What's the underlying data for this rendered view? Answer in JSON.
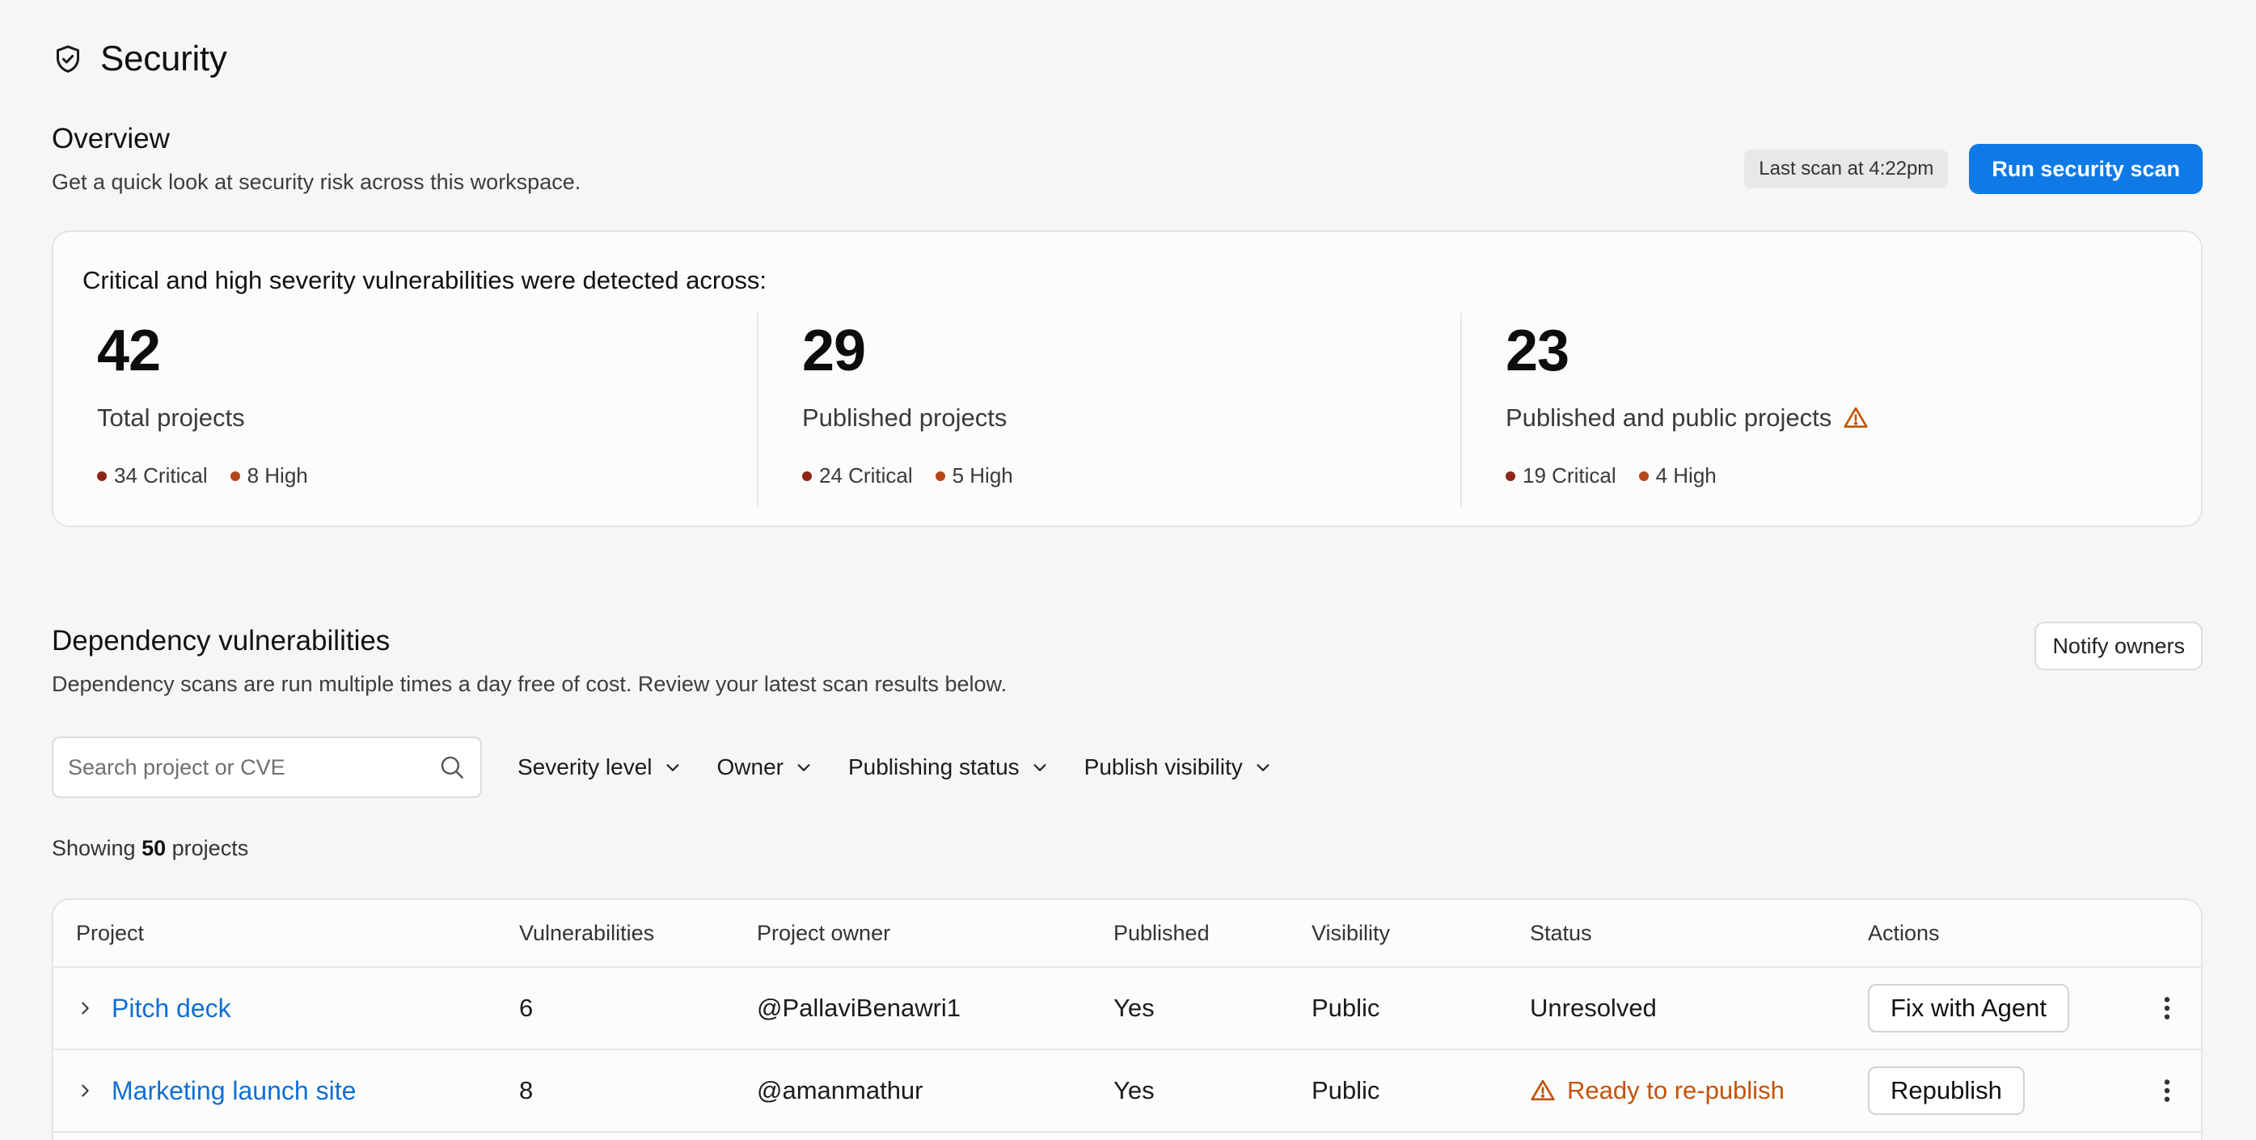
{
  "page": {
    "title": "Security",
    "icon": "shield-check-icon"
  },
  "overview": {
    "title": "Overview",
    "description": "Get a quick look at security risk across this workspace.",
    "last_scan": "Last scan at 4:22pm",
    "run_scan_label": "Run security scan",
    "accent_color": "#0f7ae5"
  },
  "summary": {
    "lead": "Critical and high severity vulnerabilities were detected across:",
    "stats": [
      {
        "value": "42",
        "label": "Total projects",
        "critical": "34 Critical",
        "high": "8 High",
        "warning": false
      },
      {
        "value": "29",
        "label": "Published projects",
        "critical": "24 Critical",
        "high": "5 High",
        "warning": false
      },
      {
        "value": "23",
        "label": "Published and public projects",
        "critical": "19 Critical",
        "high": "4 High",
        "warning": true
      }
    ],
    "critical_color": "#8e2618",
    "high_color": "#b7471a"
  },
  "dependencies": {
    "title": "Dependency vulnerabilities",
    "description": "Dependency scans are run multiple times a day free of cost. Review your latest scan results below.",
    "notify_label": "Notify owners",
    "search_placeholder": "Search project or CVE",
    "filters": [
      "Severity level",
      "Owner",
      "Publishing status",
      "Publish visibility"
    ],
    "showing_prefix": "Showing",
    "showing_count": "50",
    "showing_suffix": "projects"
  },
  "table": {
    "columns": [
      "Project",
      "Vulnerabilities",
      "Project owner",
      "Published",
      "Visibility",
      "Status",
      "Actions"
    ],
    "rows": [
      {
        "project": "Pitch deck",
        "vulnerabilities": "6",
        "owner": "@PallaviBenawri1",
        "published": "Yes",
        "visibility": "Public",
        "status": "Unresolved",
        "status_warning": false,
        "action": "Fix with Agent"
      },
      {
        "project": "Marketing launch site",
        "vulnerabilities": "8",
        "owner": "@amanmathur",
        "published": "Yes",
        "visibility": "Public",
        "status": "Ready to re-publish",
        "status_warning": true,
        "action": "Republish"
      }
    ],
    "warning_color": "#c4520b",
    "link_color": "#0f6fd6"
  }
}
